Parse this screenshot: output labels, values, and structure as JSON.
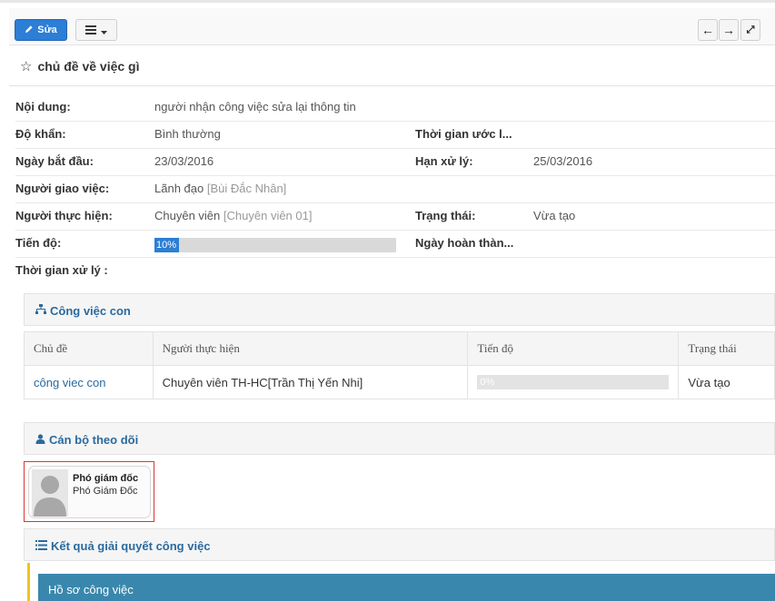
{
  "toolbar": {
    "edit_label": "Sửa"
  },
  "task": {
    "title": "chủ đề về việc gì"
  },
  "details": {
    "content": {
      "label": "Nội dung:",
      "value": "người nhận công việc sửa lại thông tin"
    },
    "urgency": {
      "label": "Độ khẩn:",
      "value": "Bình thường"
    },
    "estimated_time": {
      "label": "Thời gian ước l..."
    },
    "start_date": {
      "label": "Ngày bắt đầu:",
      "value": "23/03/2016"
    },
    "deadline": {
      "label": "Hạn xử lý:",
      "value": "25/03/2016"
    },
    "assigner": {
      "label": "Người giao việc:",
      "role": "Lãnh đạo",
      "name": "[Bùi Đắc Nhân]"
    },
    "assignee": {
      "label": "Người thực hiện:",
      "role": "Chuyên viên",
      "name": "[Chuyên viên 01]"
    },
    "status": {
      "label": "Trạng thái:",
      "value": "Vừa tạo"
    },
    "progress": {
      "label": "Tiến độ:",
      "value": 0.1,
      "text": "10%"
    },
    "completion_date": {
      "label": "Ngày hoàn thàn..."
    },
    "processing_time": {
      "label": "Thời gian xử lý :"
    }
  },
  "subtasks": {
    "title": "Công việc con",
    "columns": [
      "Chủ đề",
      "Người thực hiện",
      "Tiến độ",
      "Trạng thái"
    ],
    "rows": [
      {
        "topic": "công viec con",
        "assignee": "Chuyên viên TH-HC[Trần Thị Yến Nhi]",
        "progress": 0,
        "progress_text": "0%",
        "status": "Vừa tạo"
      }
    ]
  },
  "followers": {
    "title": "Cán bộ theo dõi",
    "people": [
      {
        "name": "Phó giám đốc",
        "role": "Phó Giám Đốc"
      }
    ]
  },
  "results": {
    "title": "Kết quả giải quyết công việc",
    "subheader": "Hồ sơ công việc"
  },
  "colors": {
    "primary": "#2c7ed6",
    "link": "#2a6a9e",
    "result_header": "#3a87ad",
    "highlight_border": "#dd3333",
    "accent_bar": "#f0c419"
  }
}
